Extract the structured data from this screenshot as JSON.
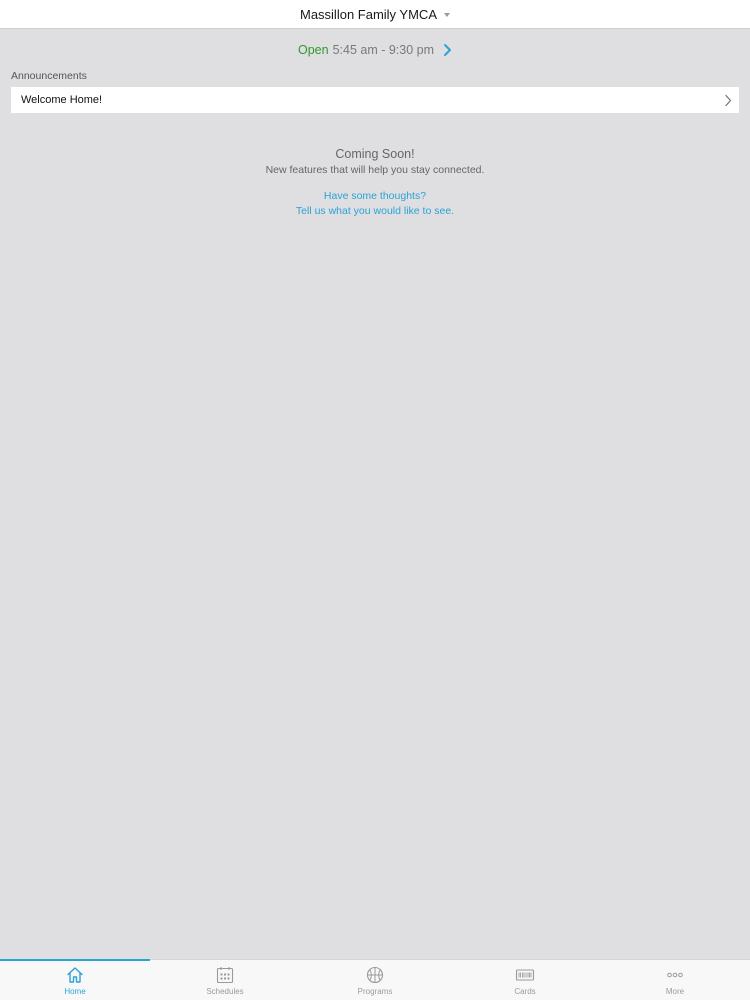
{
  "header": {
    "location_name": "Massillon Family YMCA",
    "picker_icon": "caret-down-icon"
  },
  "hours": {
    "status": "Open",
    "time": "5:45 am - 9:30 pm",
    "status_color": "#2e9a2e",
    "chevron_icon": "chevron-right-icon"
  },
  "announcements": {
    "section_label": "Announcements",
    "items": [
      {
        "title": "Welcome Home!"
      }
    ]
  },
  "coming_soon": {
    "title": "Coming Soon!",
    "subtitle": "New features that will help you stay connected.",
    "link_line1": "Have some thoughts?",
    "link_line2": "Tell us what you would like to see."
  },
  "tabs": [
    {
      "label": "Home",
      "icon": "home-icon",
      "active": true
    },
    {
      "label": "Schedules",
      "icon": "calendar-icon",
      "active": false
    },
    {
      "label": "Programs",
      "icon": "basketball-icon",
      "active": false
    },
    {
      "label": "Cards",
      "icon": "card-icon",
      "active": false
    },
    {
      "label": "More",
      "icon": "more-dots-icon",
      "active": false
    }
  ],
  "colors": {
    "accent": "#2aa3d7",
    "background": "#dfdee0",
    "tab_inactive": "#9a9a9a"
  }
}
